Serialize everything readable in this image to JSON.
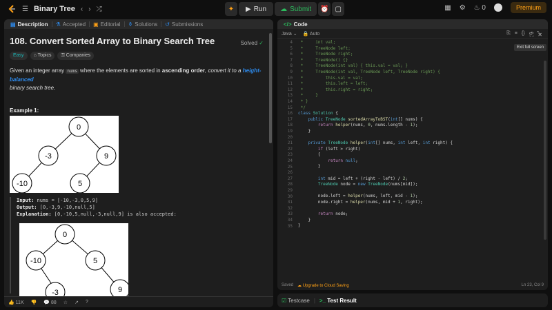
{
  "topbar": {
    "title": "Binary Tree",
    "run_label": "Run",
    "submit_label": "Submit",
    "streak": "0",
    "premium_label": "Premium"
  },
  "left_tabs": [
    {
      "label": "Description"
    },
    {
      "label": "Accepted"
    },
    {
      "label": "Editorial"
    },
    {
      "label": "Solutions"
    },
    {
      "label": "Submissions"
    }
  ],
  "problem": {
    "title": "108. Convert Sorted Array to Binary Search Tree",
    "status": "Solved",
    "tags": [
      "Easy",
      "Topics",
      "Companies"
    ],
    "desc_1": "Given an integer array ",
    "desc_code": "nums",
    "desc_2": " where the elements are sorted in ",
    "desc_bold": "ascending order",
    "desc_3": ", convert it to a ",
    "desc_link": "height-balanced",
    "desc_4": "binary search tree.",
    "example_title": "Example 1:",
    "input_label": "Input:",
    "input_value": " nums = [-10,-3,0,5,9]",
    "output_label": "Output:",
    "output_value": " [0,-3,9,-10,null,5]",
    "explain_label": "Explanation:",
    "explain_value": " [0,-10,5,null,-3,null,9] is also accepted:"
  },
  "tree1": {
    "root": "0",
    "l": "-3",
    "r": "9",
    "ll": "-10",
    "rl": "5"
  },
  "tree2": {
    "root": "0",
    "l": "-10",
    "r": "5",
    "lr": "-3",
    "rr": "9"
  },
  "left_footer": {
    "likes": "11K",
    "comments": "88"
  },
  "code_panel": {
    "title": "Code",
    "language": "Java",
    "mode": "Auto",
    "tooltip": "Exit full screen",
    "saved": "Saved",
    "upgrade": "Upgrade to Cloud Saving",
    "cursor": "Ln 23, Col 9"
  },
  "code_lines": {
    "l4": " *     int val;",
    "l5": " *     TreeNode left;",
    "l6": " *     TreeNode right;",
    "l7": " *     TreeNode() {}",
    "l8": " *     TreeNode(int val) { this.val = val; }",
    "l9": " *     TreeNode(int val, TreeNode left, TreeNode right) {",
    "l10": " *         this.val = val;",
    "l11": " *         this.left = left;",
    "l12": " *         this.right = right;",
    "l13": " *     }",
    "l14": " * }",
    "l15": " */"
  },
  "bottom_tabs": {
    "testcase": "Testcase",
    "result": "Test Result"
  }
}
